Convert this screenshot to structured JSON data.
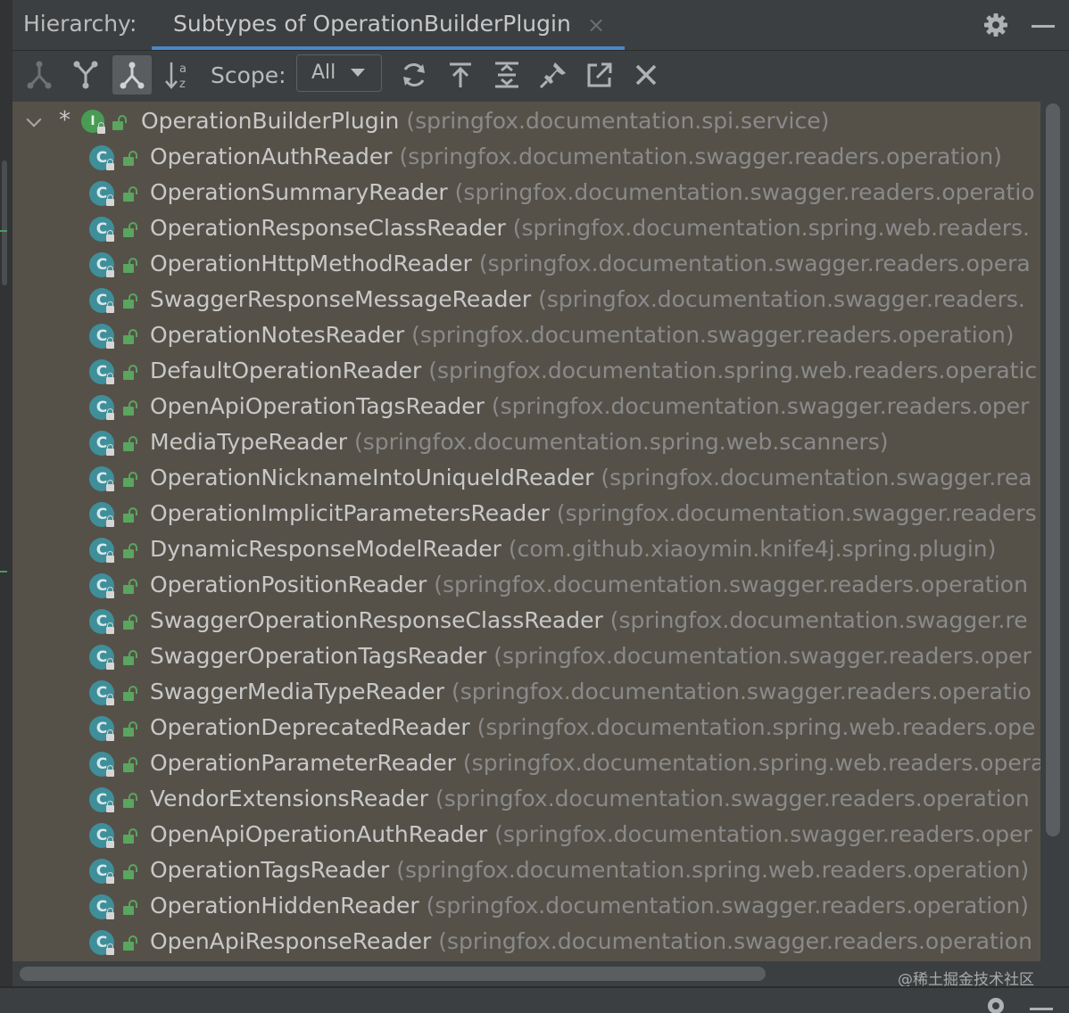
{
  "header": {
    "label": "Hierarchy:",
    "tab_title": "Subtypes of OperationBuilderPlugin",
    "tab_close": "×"
  },
  "toolbar": {
    "scope_label": "Scope:",
    "scope_value": "All",
    "buttons": [
      {
        "name": "supertypes-hierarchy-button",
        "icon": "supertypes-icon"
      },
      {
        "name": "class-hierarchy-button",
        "icon": "class-hierarchy-icon"
      },
      {
        "name": "subtypes-hierarchy-button",
        "icon": "subtypes-icon",
        "active": true
      },
      {
        "name": "sort-alphabetically-button",
        "icon": "sort-alpha-icon"
      },
      {
        "name": "refresh-button",
        "icon": "refresh-icon"
      },
      {
        "name": "export-button",
        "icon": "export-icon"
      },
      {
        "name": "expand-all-button",
        "icon": "expand-all-icon"
      },
      {
        "name": "pin-button",
        "icon": "pin-icon"
      },
      {
        "name": "open-in-editor-button",
        "icon": "open-external-icon"
      },
      {
        "name": "close-button",
        "icon": "close-icon"
      }
    ]
  },
  "tree": {
    "root": {
      "marker": "*",
      "name": "OperationBuilderPlugin",
      "package": "(springfox.documentation.spi.service)",
      "icon": "interface-icon",
      "icon_letter": "I"
    },
    "class_icon_letter": "C",
    "items": [
      {
        "name": "OperationAuthReader",
        "package": "(springfox.documentation.swagger.readers.operation)"
      },
      {
        "name": "OperationSummaryReader",
        "package": "(springfox.documentation.swagger.readers.operatio"
      },
      {
        "name": "OperationResponseClassReader",
        "package": "(springfox.documentation.spring.web.readers."
      },
      {
        "name": "OperationHttpMethodReader",
        "package": "(springfox.documentation.swagger.readers.opera"
      },
      {
        "name": "SwaggerResponseMessageReader",
        "package": "(springfox.documentation.swagger.readers."
      },
      {
        "name": "OperationNotesReader",
        "package": "(springfox.documentation.swagger.readers.operation)"
      },
      {
        "name": "DefaultOperationReader",
        "package": "(springfox.documentation.spring.web.readers.operatic"
      },
      {
        "name": "OpenApiOperationTagsReader",
        "package": "(springfox.documentation.swagger.readers.oper"
      },
      {
        "name": "MediaTypeReader",
        "package": "(springfox.documentation.spring.web.scanners)"
      },
      {
        "name": "OperationNicknameIntoUniqueIdReader",
        "package": "(springfox.documentation.swagger.rea"
      },
      {
        "name": "OperationImplicitParametersReader",
        "package": "(springfox.documentation.swagger.readers"
      },
      {
        "name": "DynamicResponseModelReader",
        "package": "(com.github.xiaoymin.knife4j.spring.plugin)"
      },
      {
        "name": "OperationPositionReader",
        "package": "(springfox.documentation.swagger.readers.operation"
      },
      {
        "name": "SwaggerOperationResponseClassReader",
        "package": "(springfox.documentation.swagger.re"
      },
      {
        "name": "SwaggerOperationTagsReader",
        "package": "(springfox.documentation.swagger.readers.oper"
      },
      {
        "name": "SwaggerMediaTypeReader",
        "package": "(springfox.documentation.swagger.readers.operatio"
      },
      {
        "name": "OperationDeprecatedReader",
        "package": "(springfox.documentation.spring.web.readers.ope"
      },
      {
        "name": "OperationParameterReader",
        "package": "(springfox.documentation.spring.web.readers.opera"
      },
      {
        "name": "VendorExtensionsReader",
        "package": "(springfox.documentation.swagger.readers.operation"
      },
      {
        "name": "OpenApiOperationAuthReader",
        "package": "(springfox.documentation.swagger.readers.oper"
      },
      {
        "name": "OperationTagsReader",
        "package": "(springfox.documentation.spring.web.readers.operation)"
      },
      {
        "name": "OperationHiddenReader",
        "package": "(springfox.documentation.swagger.readers.operation)"
      },
      {
        "name": "OpenApiResponseReader",
        "package": "(springfox.documentation.swagger.readers.operation"
      }
    ]
  },
  "watermark": "@稀土掘金技术社区",
  "colors": {
    "background": "#3c3f41",
    "tree_background": "#555149",
    "class_icon": "#3f8f9a",
    "interface_icon": "#499c54",
    "public_lock": "#5aa55f",
    "tab_underline": "#4a88c7",
    "name_text": "#c8c8c8",
    "package_text": "#8a8a8a"
  }
}
